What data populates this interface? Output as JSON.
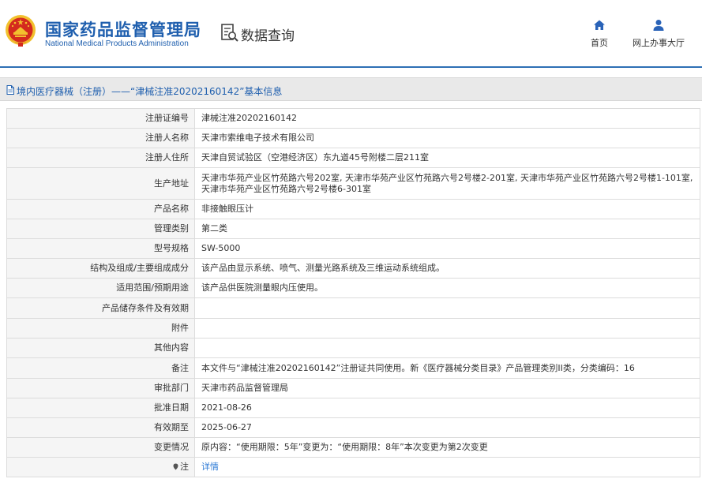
{
  "header": {
    "brand_cn": "国家药品监督管理局",
    "brand_en": "National Medical Products Administration",
    "query_title": "数据查询",
    "nav": [
      {
        "label": "首页",
        "icon": "home-icon"
      },
      {
        "label": "网上办事大厅",
        "icon": "user-icon"
      }
    ]
  },
  "breadcrumb": {
    "text": "境内医疗器械（注册）——“津械注准20202160142”基本信息"
  },
  "colors": {
    "brand_blue": "#1f5fae",
    "link_blue": "#2e7bd6",
    "label_bg": "#f5f5f5",
    "crumb_bg": "#e9e9e9",
    "emblem_red": "#d42a1e",
    "emblem_gold": "#f2c12e"
  },
  "rows": [
    {
      "label": "注册证编号",
      "value": "津械注准20202160142"
    },
    {
      "label": "注册人名称",
      "value": "天津市索维电子技术有限公司"
    },
    {
      "label": "注册人住所",
      "value": "天津自贸试验区（空港经济区）东九道45号附楼二层211室"
    },
    {
      "label": "生产地址",
      "value": "天津市华苑产业区竹苑路六号202室, 天津市华苑产业区竹苑路六号2号楼2-201室, 天津市华苑产业区竹苑路六号2号楼1-101室, 天津市华苑产业区竹苑路六号2号楼6-301室"
    },
    {
      "label": "产品名称",
      "value": "非接触眼压计"
    },
    {
      "label": "管理类别",
      "value": "第二类"
    },
    {
      "label": "型号规格",
      "value": "SW-5000"
    },
    {
      "label": "结构及组成/主要组成成分",
      "value": "该产品由显示系统、喷气、测量光路系统及三维运动系统组成。"
    },
    {
      "label": "适用范围/预期用途",
      "value": "该产品供医院测量眼内压使用。"
    },
    {
      "label": "产品储存条件及有效期",
      "value": ""
    },
    {
      "label": "附件",
      "value": ""
    },
    {
      "label": "其他内容",
      "value": ""
    },
    {
      "label": "备注",
      "value": "本文件与“津械注准20202160142”注册证共同使用。新《医疗器械分类目录》产品管理类别II类，分类编码：16"
    },
    {
      "label": "审批部门",
      "value": "天津市药品监督管理局"
    },
    {
      "label": "批准日期",
      "value": "2021-08-26"
    },
    {
      "label": "有效期至",
      "value": "2025-06-27"
    },
    {
      "label": "变更情况",
      "value": "原内容：“使用期限：5年”变更为：“使用期限：8年”本次变更为第2次变更"
    }
  ],
  "note_row": {
    "label": "注",
    "icon": "note-icon",
    "link": "详情"
  }
}
